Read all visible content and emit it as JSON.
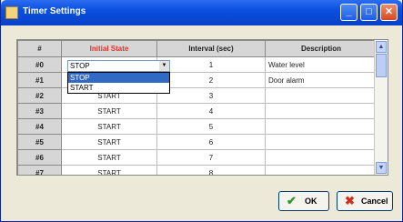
{
  "window": {
    "title": "Timer Settings"
  },
  "table": {
    "headers": [
      "#",
      "Initial State",
      "Interval (sec)",
      "Description"
    ],
    "rows": [
      {
        "index": "#0",
        "state": "STOP",
        "interval": "1",
        "description": "Water level"
      },
      {
        "index": "#1",
        "state": "START",
        "interval": "2",
        "description": "Door alarm"
      },
      {
        "index": "#2",
        "state": "START",
        "interval": "3",
        "description": ""
      },
      {
        "index": "#3",
        "state": "START",
        "interval": "4",
        "description": ""
      },
      {
        "index": "#4",
        "state": "START",
        "interval": "5",
        "description": ""
      },
      {
        "index": "#5",
        "state": "START",
        "interval": "6",
        "description": ""
      },
      {
        "index": "#6",
        "state": "START",
        "interval": "7",
        "description": ""
      },
      {
        "index": "#7",
        "state": "START",
        "interval": "8",
        "description": ""
      }
    ]
  },
  "dropdown": {
    "current_value": "STOP",
    "options": [
      "STOP",
      "START"
    ],
    "highlighted": "STOP"
  },
  "buttons": {
    "ok": "OK",
    "cancel": "Cancel"
  },
  "colors": {
    "title_bar": "#0a4fe0",
    "header_accent": "#e0362c",
    "selection": "#316ac5",
    "ok_icon": "#2e9a2e",
    "cancel_icon": "#d2301e"
  }
}
